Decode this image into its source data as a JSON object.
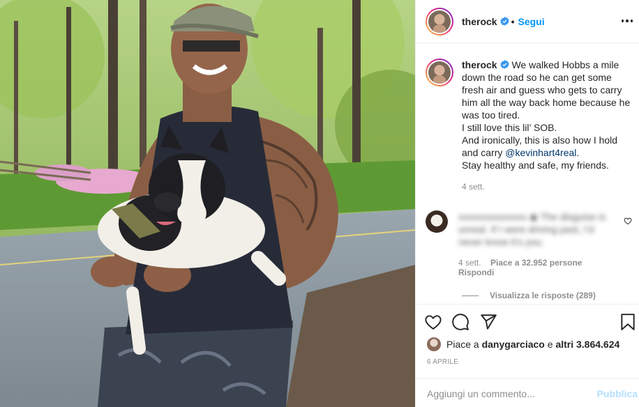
{
  "header": {
    "username": "therock",
    "dot": "•",
    "follow_label": "Segui"
  },
  "caption": {
    "username": "therock",
    "line1": "We walked Hobbs a mile down the road so he can get some fresh air and guess who gets to carry him all the way back home because he was too tired.",
    "line2": "I still love this lil’ SOB.",
    "line3_pre": "And ironically, this is also how I hold and carry ",
    "mention": "@kevinhart4real",
    "line3_post": ".",
    "line4": "Stay healthy and safe, my friends.",
    "time": "4 sett."
  },
  "comment": {
    "blurred_text": "xxxxxxxxxxxxxx ◉ The disguise is unreal. If I were driving past, I’d never know it’s you.",
    "time": "4 sett.",
    "likes": "Piace a 32.952 persone",
    "reply_label": "Rispondi",
    "view_replies": "Visualizza le risposte (289)"
  },
  "actions": {
    "likes_prefix": "Piace a ",
    "liker": "danygarciaco",
    "likes_mid": " e ",
    "likes_count": "altri 3.864.624",
    "date": "6 APRILE",
    "comment_placeholder": "Aggiungi un commento...",
    "publish_label": "Pubblica"
  },
  "colors": {
    "link_blue": "#0095f6",
    "mention_blue": "#00376b",
    "muted": "#8e8e8e",
    "publish_disabled": "#b2dffc"
  },
  "icons": [
    "heart-icon",
    "comment-icon",
    "share-icon",
    "bookmark-icon",
    "more-options-icon",
    "verified-badge-icon"
  ]
}
